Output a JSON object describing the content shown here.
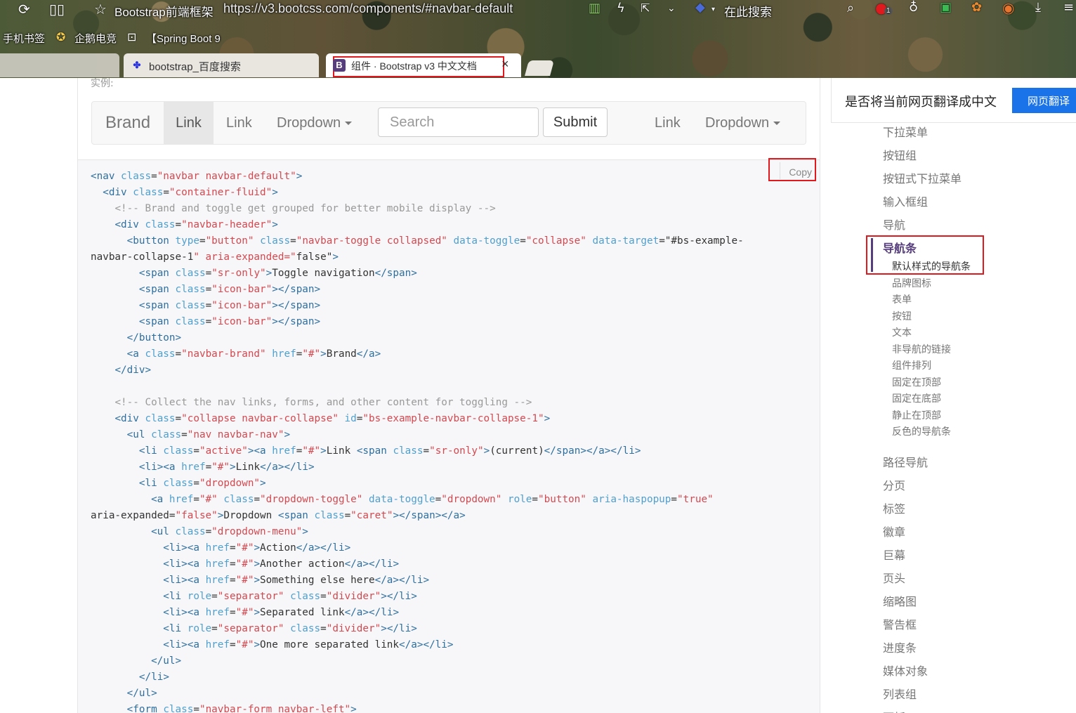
{
  "browser": {
    "title": "Bootstrap前端框架",
    "url": "https://v3.bootcss.com/components/#navbar-default",
    "search_engine_label": "在此搜索",
    "bookmarks": [
      "手机书签",
      "企鹅电竞",
      "【Spring Boot 9"
    ],
    "tabs": [
      {
        "label": "bootstrap_百度搜索",
        "active": false
      },
      {
        "label": "组件 · Bootstrap v3 中文文档",
        "active": true
      }
    ],
    "close_glyph": "×",
    "badge_count": "1"
  },
  "page": {
    "example_label": "实例:",
    "navbar": {
      "brand": "Brand",
      "link_active": "Link",
      "link": "Link",
      "dropdown": "Dropdown",
      "search_placeholder": "Search",
      "submit": "Submit",
      "right_link": "Link",
      "right_dropdown": "Dropdown"
    },
    "copy_label": "Copy",
    "code_lines": [
      "<nav class=\"navbar navbar-default\">",
      "  <div class=\"container-fluid\">",
      "    <!-- Brand and toggle get grouped for better mobile display -->",
      "    <div class=\"navbar-header\">",
      "      <button type=\"button\" class=\"navbar-toggle collapsed\" data-toggle=\"collapse\" data-target=\"#bs-example-",
      "navbar-collapse-1\" aria-expanded=\"false\">",
      "        <span class=\"sr-only\">Toggle navigation</span>",
      "        <span class=\"icon-bar\"></span>",
      "        <span class=\"icon-bar\"></span>",
      "        <span class=\"icon-bar\"></span>",
      "      </button>",
      "      <a class=\"navbar-brand\" href=\"#\">Brand</a>",
      "    </div>",
      "",
      "    <!-- Collect the nav links, forms, and other content for toggling -->",
      "    <div class=\"collapse navbar-collapse\" id=\"bs-example-navbar-collapse-1\">",
      "      <ul class=\"nav navbar-nav\">",
      "        <li class=\"active\"><a href=\"#\">Link <span class=\"sr-only\">(current)</span></a></li>",
      "        <li><a href=\"#\">Link</a></li>",
      "        <li class=\"dropdown\">",
      "          <a href=\"#\" class=\"dropdown-toggle\" data-toggle=\"dropdown\" role=\"button\" aria-haspopup=\"true\"",
      "aria-expanded=\"false\">Dropdown <span class=\"caret\"></span></a>",
      "          <ul class=\"dropdown-menu\">",
      "            <li><a href=\"#\">Action</a></li>",
      "            <li><a href=\"#\">Another action</a></li>",
      "            <li><a href=\"#\">Something else here</a></li>",
      "            <li role=\"separator\" class=\"divider\"></li>",
      "            <li><a href=\"#\">Separated link</a></li>",
      "            <li role=\"separator\" class=\"divider\"></li>",
      "            <li><a href=\"#\">One more separated link</a></li>",
      "          </ul>",
      "        </li>",
      "      </ul>",
      "      <form class=\"navbar-form navbar-left\">"
    ]
  },
  "translate": {
    "prompt": "是否将当前网页翻译成中文",
    "button": "网页翻译"
  },
  "sidebar": {
    "items_top": [
      "下拉菜单",
      "按钮组",
      "按钮式下拉菜单",
      "输入框组",
      "导航"
    ],
    "selected": "导航条",
    "sub_items": [
      "默认样式的导航条",
      "品牌图标",
      "表单",
      "按钮",
      "文本",
      "非导航的链接",
      "组件排列",
      "固定在顶部",
      "固定在底部",
      "静止在顶部",
      "反色的导航条"
    ],
    "items_bottom": [
      "路径导航",
      "分页",
      "标签",
      "徽章",
      "巨幕",
      "页头",
      "缩略图",
      "警告框",
      "进度条",
      "媒体对象",
      "列表组",
      "面板"
    ]
  },
  "colors": {
    "highlight_border": "#e0191e",
    "translate_button": "#1a73e8",
    "bootstrap_purple": "#563d7c"
  }
}
